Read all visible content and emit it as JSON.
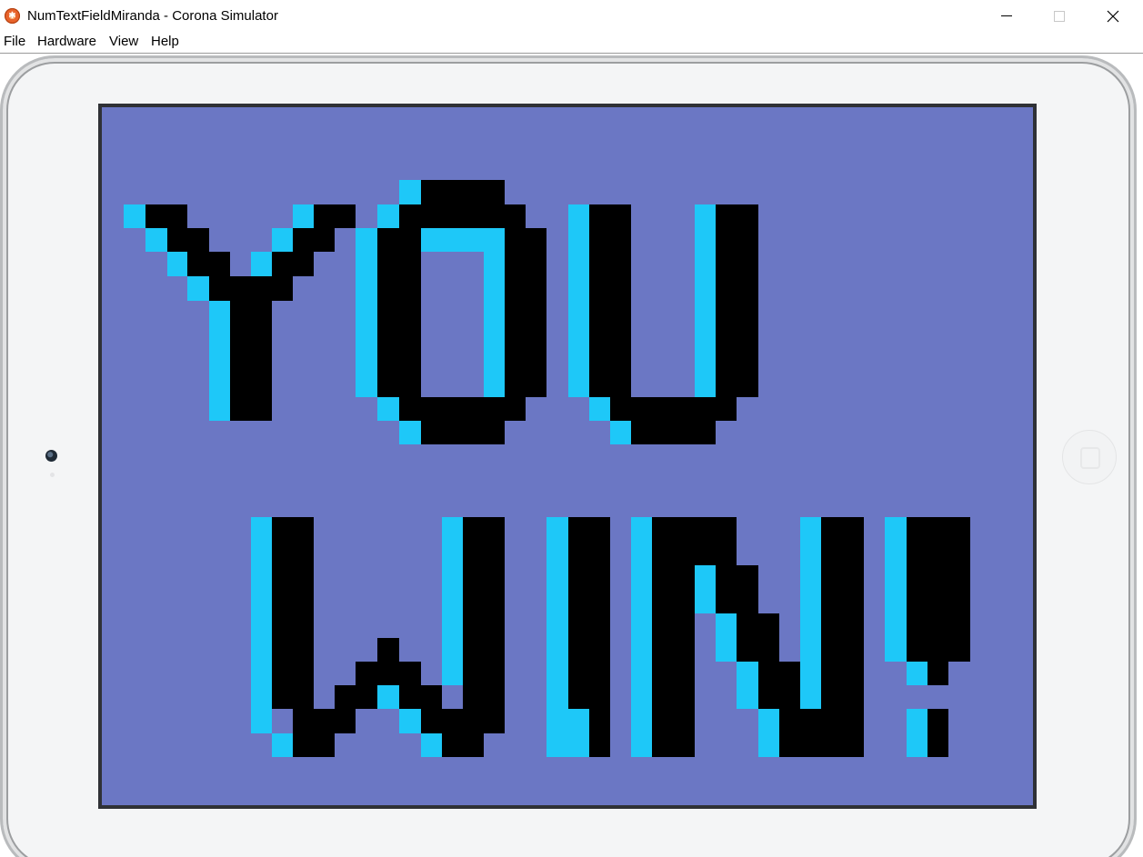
{
  "window": {
    "title": "NumTextFieldMiranda - Corona Simulator"
  },
  "menu": {
    "items": [
      "File",
      "Hardware",
      "View",
      "Help"
    ]
  },
  "icons": {
    "app": "corona-logo-icon",
    "minimize": "minimize-icon",
    "maximize": "maximize-icon",
    "close": "close-icon"
  },
  "colors": {
    "screen_background": "#6b77c4",
    "text_fill": "#000000",
    "text_highlight": "#1ec8f8",
    "device_frame": "#f4f5f6"
  },
  "game": {
    "message_line1": "YOU",
    "message_line2": "WIN!"
  }
}
